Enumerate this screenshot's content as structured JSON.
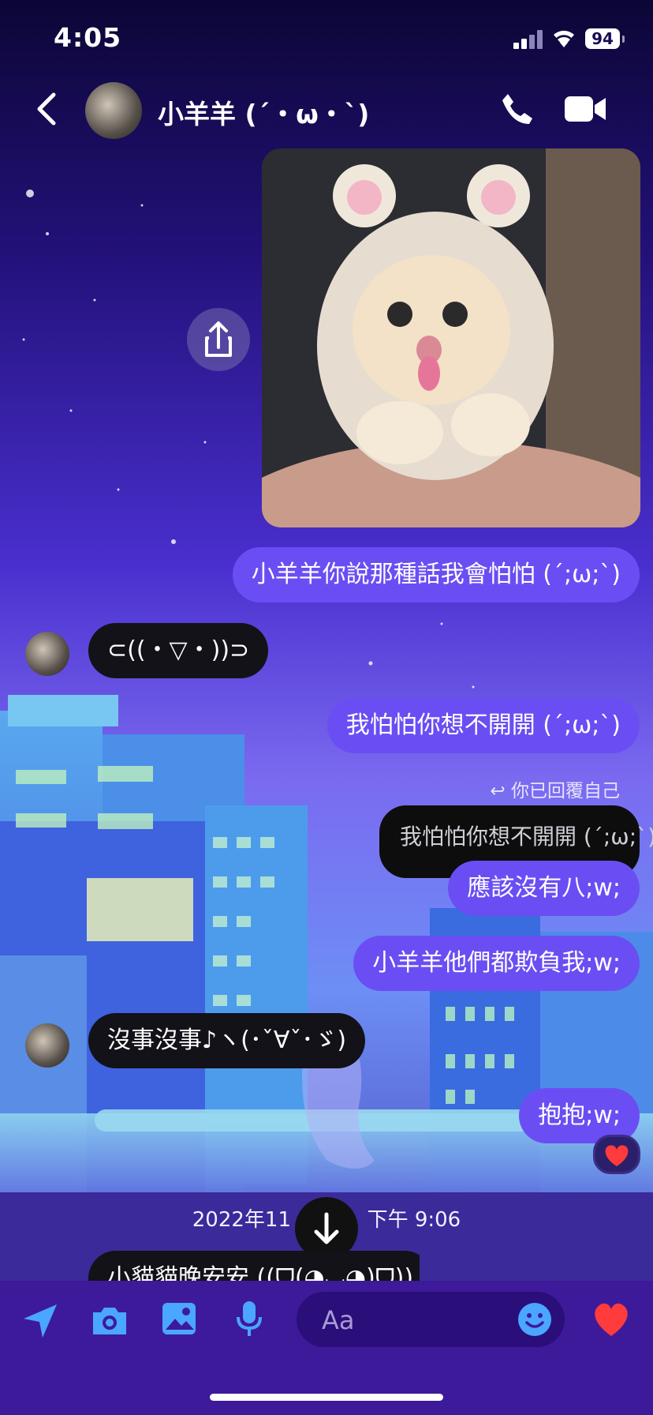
{
  "status_bar": {
    "time": "4:05",
    "battery": "94"
  },
  "header": {
    "contact_name": "小羊羊 (´・ω・`)"
  },
  "messages": [
    {
      "id": "m1",
      "side": "me",
      "text": "小羊羊你說那種話我會怕怕 (´;ω;`)"
    },
    {
      "id": "m2",
      "side": "them",
      "text": "⊂((・▽・))⊃"
    },
    {
      "id": "m3",
      "side": "me",
      "text": "我怕怕你想不開開 (´;ω;`)"
    },
    {
      "id": "m4",
      "side": "me",
      "reply_label": "你已回覆自己",
      "quoted": "我怕怕你想不開開 (´;ω;`)",
      "text": "應該沒有八;w;"
    },
    {
      "id": "m5",
      "side": "me",
      "text": "小羊羊他們都欺負我;w;"
    },
    {
      "id": "m6",
      "side": "them",
      "text": "沒事沒事♪ヽ(･ˇ∀ˇ･ゞ)"
    },
    {
      "id": "m7",
      "side": "me",
      "text": "抱抱;w;",
      "reaction": "❤️"
    }
  ],
  "date_separator": {
    "left": "2022年11",
    "right": "下午 9:06"
  },
  "partial_message": "小貓貓晚安安 ((ᗜ(◕◡◕)ᗜ))",
  "composer": {
    "placeholder": "Aa"
  },
  "colors": {
    "accent": "#6a4ef3",
    "toolbar": "#3d1a9a",
    "their_bubble": "#121218",
    "reaction": "#ff3b3b"
  },
  "icons": [
    "back-icon",
    "phone-icon",
    "video-camera-icon",
    "share-icon",
    "arrow-down-icon",
    "location-arrow-icon",
    "camera-icon",
    "gallery-icon",
    "microphone-icon",
    "emoji-icon",
    "heart-icon",
    "signal-icon",
    "wifi-icon"
  ]
}
